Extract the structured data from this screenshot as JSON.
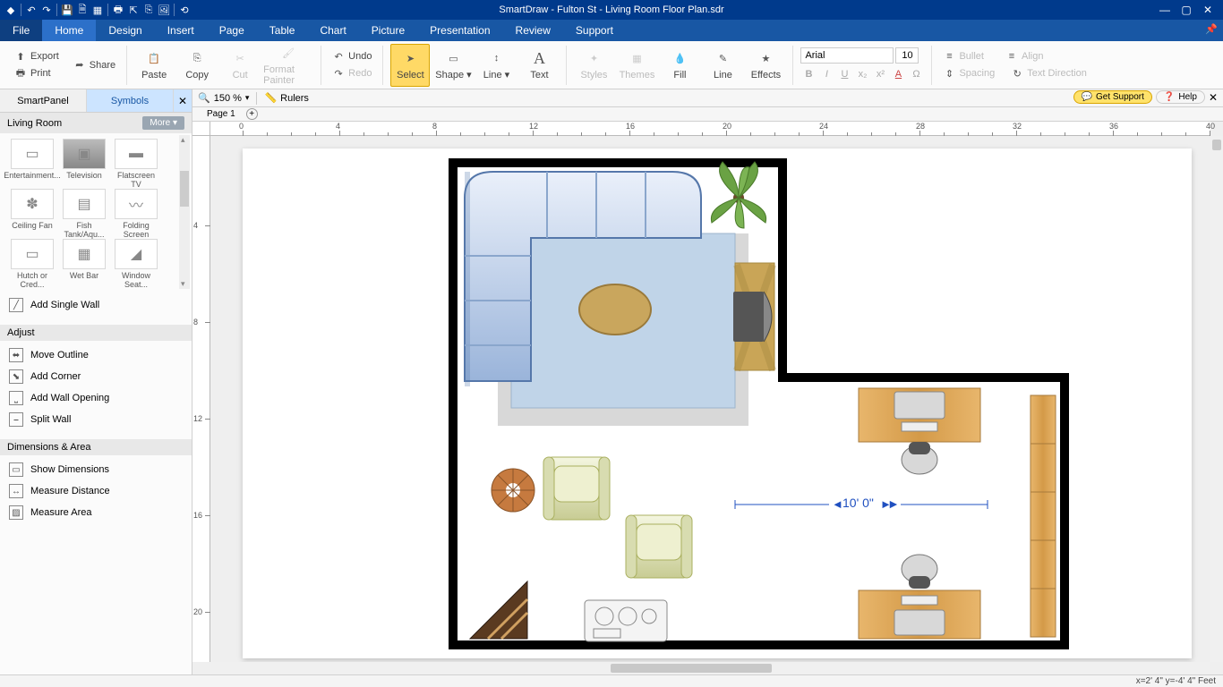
{
  "app": {
    "title": "SmartDraw - Fulton St - Living Room Floor Plan.sdr"
  },
  "menus": {
    "items": [
      "File",
      "Home",
      "Design",
      "Insert",
      "Page",
      "Table",
      "Chart",
      "Picture",
      "Presentation",
      "Review",
      "Support"
    ],
    "active": "Home"
  },
  "ribbon": {
    "export": "Export",
    "print": "Print",
    "share": "Share",
    "paste": "Paste",
    "copy": "Copy",
    "cut": "Cut",
    "format_painter": "Format Painter",
    "undo": "Undo",
    "redo": "Redo",
    "select": "Select",
    "shape": "Shape",
    "line": "Line",
    "text": "Text",
    "styles": "Styles",
    "themes": "Themes",
    "fill": "Fill",
    "line2": "Line",
    "effects": "Effects",
    "font_name": "Arial",
    "font_size": "10",
    "bullet": "Bullet",
    "align": "Align",
    "spacing": "Spacing",
    "text_direction": "Text Direction"
  },
  "panel": {
    "tabs": {
      "smartpanel": "SmartPanel",
      "symbols": "Symbols"
    },
    "category": "Living Room",
    "more": "More",
    "symbols": [
      {
        "label": "Entertainment...",
        "icon": "ent"
      },
      {
        "label": "Television",
        "icon": "tv"
      },
      {
        "label": "Flatscreen TV",
        "icon": "flat"
      },
      {
        "label": "Ceiling Fan",
        "icon": "fan"
      },
      {
        "label": "Fish Tank/Aqu...",
        "icon": "fish"
      },
      {
        "label": "Folding Screen",
        "icon": "fold"
      },
      {
        "label": "Hutch or Cred...",
        "icon": "hutch"
      },
      {
        "label": "Wet Bar",
        "icon": "wet"
      },
      {
        "label": "Window Seat...",
        "icon": "wseat"
      }
    ],
    "add_single_wall": "Add Single Wall",
    "adjust_header": "Adjust",
    "adjust_items": [
      "Move Outline",
      "Add Corner",
      "Add Wall Opening",
      "Split Wall"
    ],
    "dim_header": "Dimensions & Area",
    "dim_items": [
      "Show Dimensions",
      "Measure Distance",
      "Measure Area"
    ]
  },
  "view": {
    "zoom": "150 %",
    "rulers": "Rulers",
    "page_label": "Page 1",
    "support": "Get Support",
    "help": "Help"
  },
  "floorplan": {
    "dimension_label": "10' 0\""
  },
  "status": {
    "coords": "x=2' 4\"   y=-4' 4\" Feet"
  },
  "ruler_marks": [
    "0",
    "4",
    "8",
    "12",
    "16",
    "20",
    "24",
    "28",
    "32",
    "36",
    "40"
  ],
  "vruler_marks": [
    "4",
    "8",
    "12",
    "16",
    "20"
  ]
}
